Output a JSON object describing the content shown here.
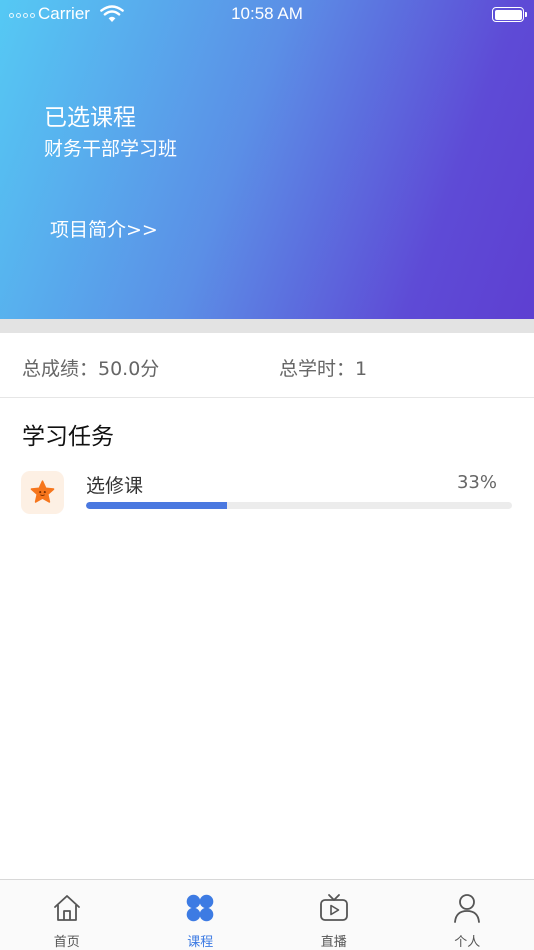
{
  "status_bar": {
    "carrier": "Carrier",
    "time": "10:58 AM"
  },
  "header": {
    "title": "已选课程",
    "course_name": "财务干部学习班",
    "intro_link": "项目简介>>"
  },
  "stats": {
    "score": "总成绩：50.0分",
    "hours": "总学时：1"
  },
  "tasks_section": {
    "title": "学习任务",
    "items": [
      {
        "name": "选修课",
        "percent_label": "33%",
        "progress": 0.33,
        "icon": "star-icon"
      }
    ]
  },
  "tabbar": {
    "active_color": "#3d7be3",
    "tabs": [
      {
        "label": "首页",
        "icon": "home-icon"
      },
      {
        "label": "课程",
        "icon": "grid-icon",
        "active": true
      },
      {
        "label": "直播",
        "icon": "tv-play-icon"
      },
      {
        "label": "个人",
        "icon": "person-icon"
      }
    ]
  },
  "colors": {
    "gradient_start": "#55c9f4",
    "gradient_end": "#5e3fd1",
    "progress": "#4a78e0",
    "star": "#f6761d"
  }
}
